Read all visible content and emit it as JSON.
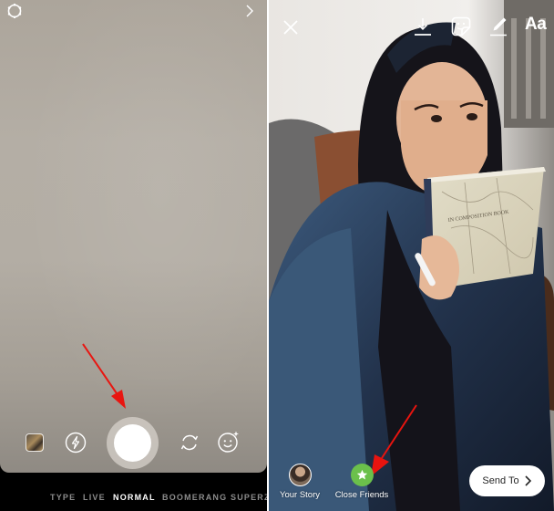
{
  "camera": {
    "top_bar": {
      "settings_icon": "gear-icon",
      "forward_icon": "chevron-right-icon"
    },
    "controls": {
      "gallery_icon": "gallery-thumbnail",
      "flash_icon": "flash-icon",
      "shutter_icon": "shutter-button",
      "flip_icon": "flip-camera-icon",
      "effects_icon": "face-effects-icon"
    },
    "modes": [
      {
        "label": "TYPE",
        "active": false
      },
      {
        "label": "LIVE",
        "active": false
      },
      {
        "label": "NORMAL",
        "active": true
      },
      {
        "label": "BOOMERANG",
        "active": false
      },
      {
        "label": "SUPERZOOM",
        "active": false
      }
    ]
  },
  "editor": {
    "tools": {
      "close_icon": "close-icon",
      "download_icon": "download-icon",
      "sticker_icon": "sticker-icon",
      "draw_icon": "pen-icon",
      "text_label": "Aa"
    },
    "share": {
      "your_story_label": "Your Story",
      "close_friends_label": "Close Friends",
      "send_to_label": "Send To"
    }
  },
  "annotations": {
    "arrow_color": "#e8140f"
  },
  "colors": {
    "close_friends_green": "#6bc04b",
    "active_mode": "#ffffff",
    "inactive_mode": "#8c8c8c"
  }
}
